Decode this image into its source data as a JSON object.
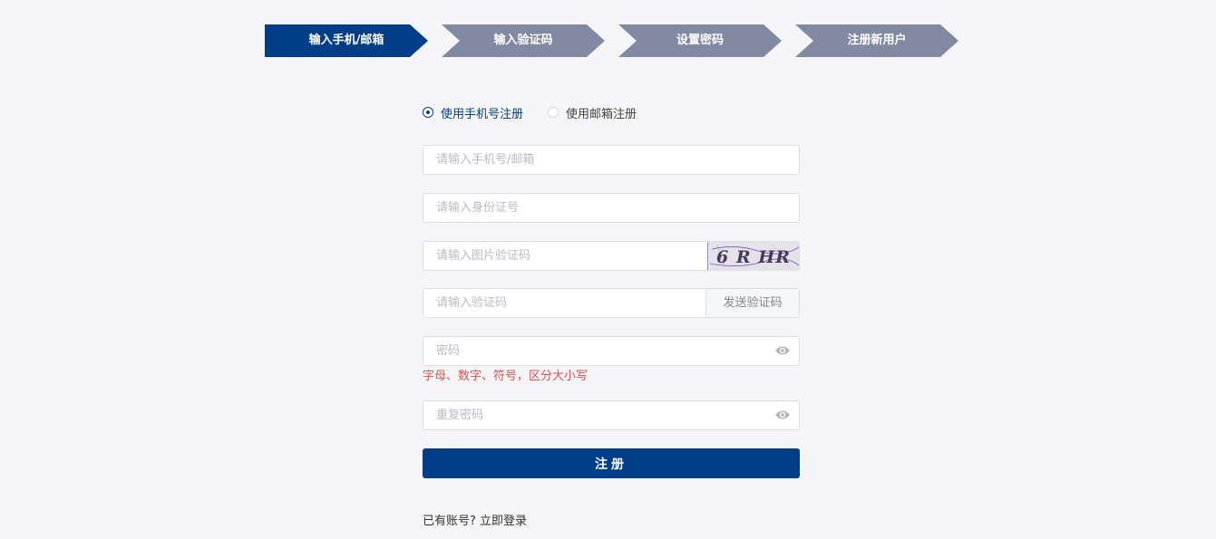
{
  "steps": [
    {
      "label": "输入手机/邮箱",
      "active": true
    },
    {
      "label": "输入验证码",
      "active": false
    },
    {
      "label": "设置密码",
      "active": false
    },
    {
      "label": "注册新用户",
      "active": false
    }
  ],
  "register_mode": {
    "options": [
      "使用手机号注册",
      "使用邮箱注册"
    ],
    "selected": "使用手机号注册"
  },
  "form": {
    "account_placeholder": "请输入手机号/邮箱",
    "id_placeholder": "请输入身份证号",
    "captcha_placeholder": "请输入图片验证码",
    "captcha_text": "6 R HR",
    "code_placeholder": "请输入验证码",
    "send_code_label": "发送验证码",
    "password_placeholder": "密码",
    "password_hint": "字母、数字、符号，区分大小写",
    "repeat_password_placeholder": "重复密码",
    "submit_label": "注册"
  },
  "login_prompt": {
    "text": "已有账号?",
    "link": "立即登录"
  },
  "colors": {
    "primary": "#013e87",
    "step_inactive": "#8289a3",
    "hint_red": "#d9534f",
    "background": "#f5f5f7"
  },
  "icons": {
    "password_toggle": "eye-icon"
  }
}
